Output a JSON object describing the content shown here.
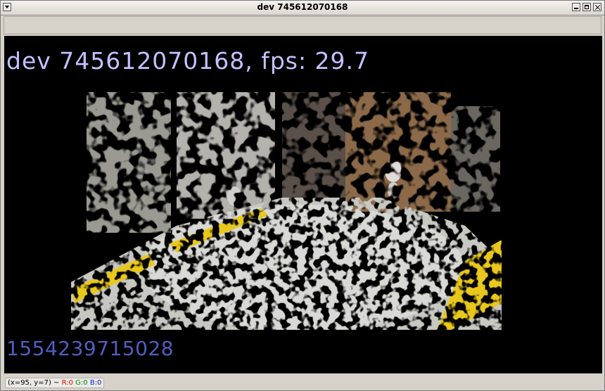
{
  "window": {
    "title": "dev 745612070168"
  },
  "overlay": {
    "title": "dev 745612070168, fps: 29.7",
    "timestamp": "1554239715028"
  },
  "status": {
    "coords": "(x=95, y=7) ~",
    "r": "R:0",
    "g": "G:0",
    "b": "B:0"
  },
  "colors": {
    "title_text": "#c4c0ff",
    "timestamp_text": "#4f5fbf",
    "canvas_bg": "#000000",
    "floor_yellow": "#e8c81a"
  },
  "icons": {
    "menu": "window-menu-icon",
    "minimize": "minimize-icon",
    "maximize": "maximize-icon",
    "close": "close-icon"
  }
}
